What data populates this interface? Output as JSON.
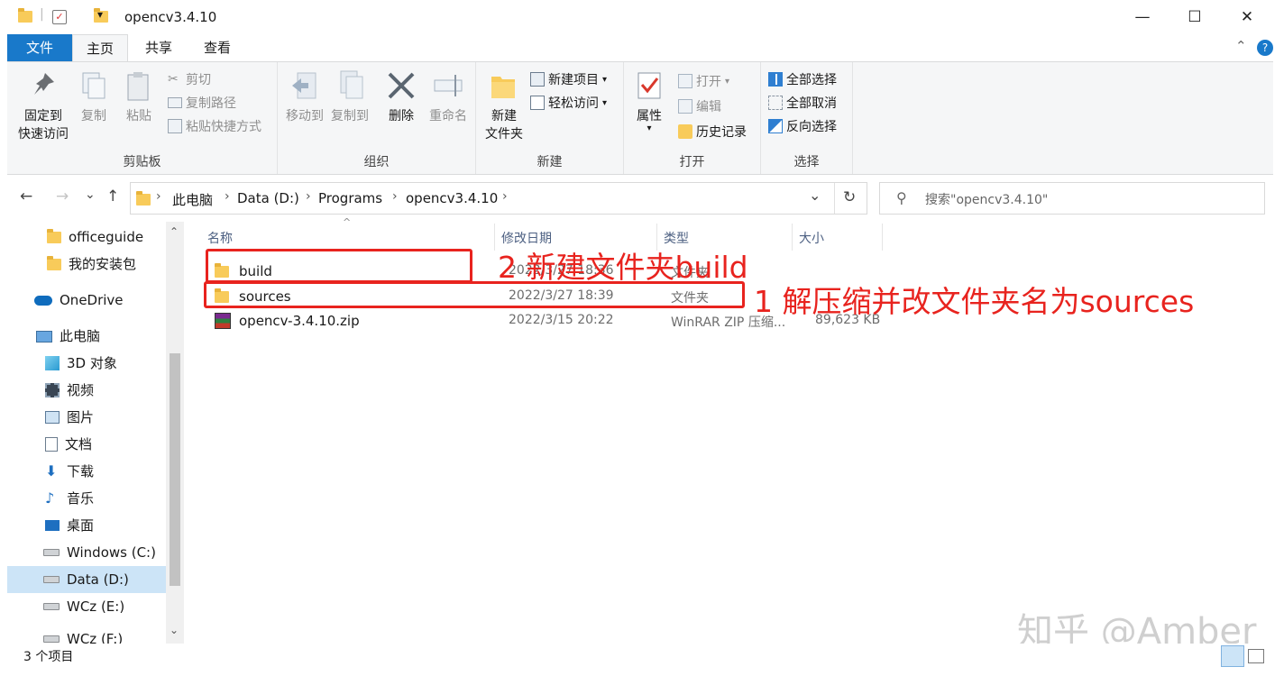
{
  "window": {
    "title": "opencv3.4.10",
    "min_glyph": "—",
    "max_glyph": "☐",
    "close_glyph": "✕"
  },
  "tabs": {
    "file": "文件",
    "home": "主页",
    "share": "共享",
    "view": "查看",
    "collapse_glyph": "⌃",
    "help_glyph": "?"
  },
  "ribbon": {
    "clipboard": {
      "label": "剪贴板",
      "pin_line1": "固定到",
      "pin_line2": "快速访问",
      "copy": "复制",
      "paste": "粘贴",
      "cut": "剪切",
      "copy_path": "复制路径",
      "paste_shortcut": "粘贴快捷方式"
    },
    "organize": {
      "label": "组织",
      "move_to": "移动到",
      "copy_to": "复制到",
      "delete": "删除",
      "rename": "重命名"
    },
    "new": {
      "label": "新建",
      "new_folder_line1": "新建",
      "new_folder_line2": "文件夹",
      "new_item": "新建项目",
      "easy_access": "轻松访问"
    },
    "open": {
      "label": "打开",
      "properties": "属性",
      "open": "打开",
      "edit": "编辑",
      "history": "历史记录"
    },
    "select": {
      "label": "选择",
      "select_all": "全部选择",
      "select_none": "全部取消",
      "invert": "反向选择"
    }
  },
  "nav": {
    "back_glyph": "←",
    "forward_glyph": "→",
    "recent_glyph": "⌄",
    "up_glyph": "↑",
    "breadcrumb": [
      "此电脑",
      "Data (D:)",
      "Programs",
      "opencv3.4.10"
    ],
    "separator": "›",
    "dropdown_glyph": "⌄",
    "refresh_glyph": "↻",
    "search_placeholder": "搜索\"opencv3.4.10\"",
    "search_glyph": "⚲"
  },
  "sidebar": {
    "items": [
      {
        "label": "officeguide",
        "icon": "folder-icon"
      },
      {
        "label": "我的安装包",
        "icon": "folder-icon"
      },
      {
        "label": "OneDrive",
        "icon": "cloud-icon"
      },
      {
        "label": "此电脑",
        "icon": "computer-icon"
      },
      {
        "label": "3D 对象",
        "icon": "cube-icon"
      },
      {
        "label": "视频",
        "icon": "video-icon"
      },
      {
        "label": "图片",
        "icon": "picture-icon"
      },
      {
        "label": "文档",
        "icon": "document-icon"
      },
      {
        "label": "下载",
        "icon": "download-icon"
      },
      {
        "label": "音乐",
        "icon": "music-icon"
      },
      {
        "label": "桌面",
        "icon": "desktop-icon"
      },
      {
        "label": "Windows (C:)",
        "icon": "drive-icon"
      },
      {
        "label": "Data (D:)",
        "icon": "drive-icon"
      },
      {
        "label": "WCz (E:)",
        "icon": "drive-icon"
      },
      {
        "label": "WCz (F:)",
        "icon": "drive-icon"
      }
    ],
    "scroll_up_glyph": "⌃",
    "scroll_down_glyph": "⌄"
  },
  "list": {
    "columns": {
      "name": "名称",
      "date": "修改日期",
      "type": "类型",
      "size": "大小"
    },
    "sort_glyph": "^",
    "rows": [
      {
        "name": "build",
        "date": "2022/3/27 18:36",
        "type": "文件夹",
        "size": ""
      },
      {
        "name": "sources",
        "date": "2022/3/27 18:39",
        "type": "文件夹",
        "size": ""
      },
      {
        "name": "opencv-3.4.10.zip",
        "date": "2022/3/15 20:22",
        "type": "WinRAR ZIP 压缩...",
        "size": "89,623 KB"
      }
    ]
  },
  "annotations": {
    "build_note": "2 新建文件夹build",
    "sources_note": "1 解压缩并改文件夹名为sources",
    "color": "#e8231e"
  },
  "status": {
    "count": "3 个项目"
  },
  "watermark": "知乎 @Amber",
  "colors": {
    "file_tab": "#1979ca",
    "selected": "#cce4f7",
    "ribbon_bg": "#f5f6f7"
  }
}
